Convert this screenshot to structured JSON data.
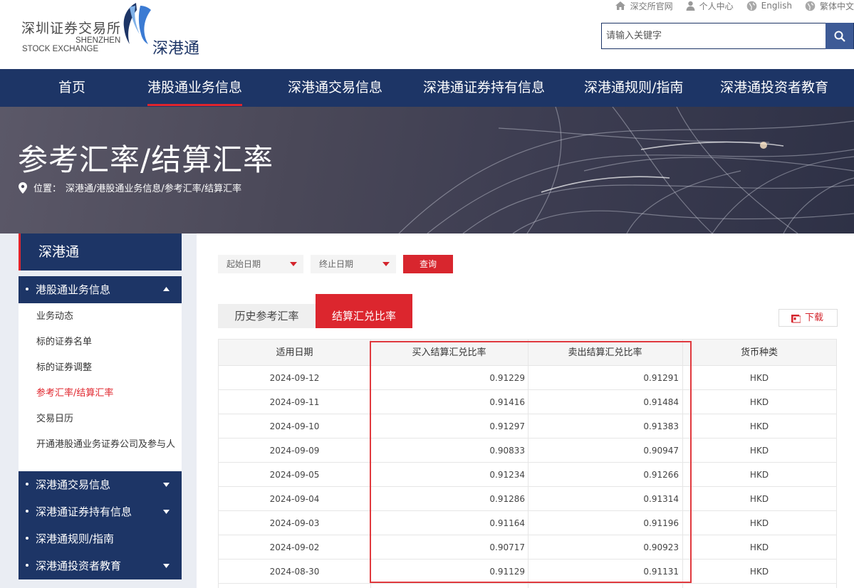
{
  "header": {
    "logo_cn": "深圳证券交易所",
    "logo_en_line1": "SHENZHEN",
    "logo_en_line2": "STOCK EXCHANGE",
    "sub_brand": "深港通",
    "top_links": [
      {
        "label": "深交所官网",
        "icon": "home-icon"
      },
      {
        "label": "个人中心",
        "icon": "user-icon"
      },
      {
        "label": "English",
        "icon": "globe-icon"
      },
      {
        "label": "繁体中文",
        "icon": "globe-icon"
      }
    ],
    "search_placeholder": "请输入关键字"
  },
  "nav": {
    "items": [
      "首页",
      "港股通业务信息",
      "深港通交易信息",
      "深港通证券持有信息",
      "深港通规则/指南",
      "深港通投资者教育"
    ],
    "active_index": 1
  },
  "banner": {
    "title": "参考汇率/结算汇率",
    "breadcrumb_prefix": "位置：",
    "breadcrumb": "深港通/港股通业务信息/参考汇率/结算汇率"
  },
  "sidebar": {
    "title": "深港通",
    "groups": [
      {
        "label": "港股通业务信息",
        "expanded": true
      },
      {
        "label": "深港通交易信息",
        "expanded": false
      },
      {
        "label": "深港通证券持有信息",
        "expanded": false
      },
      {
        "label": "深港通规则/指南",
        "expanded": false
      },
      {
        "label": "深港通投资者教育",
        "expanded": false
      }
    ],
    "sub_items": [
      "业务动态",
      "标的证券名单",
      "标的证券调整",
      "参考汇率/结算汇率",
      "交易日历",
      "开通港股通业务证券公司及参与人"
    ],
    "active_sub_index": 3
  },
  "filters": {
    "start_date_placeholder": "起始日期",
    "end_date_placeholder": "终止日期",
    "query_label": "查询"
  },
  "tabs": {
    "history": "历史参考汇率",
    "settlement": "结算汇兑比率",
    "active": "settlement"
  },
  "download_label": "下载",
  "table": {
    "headers": [
      "适用日期",
      "买入结算汇兑比率",
      "卖出结算汇兑比率",
      "货币种类"
    ],
    "rows": [
      [
        "2024-09-12",
        "0.91229",
        "0.91291",
        "HKD"
      ],
      [
        "2024-09-11",
        "0.91416",
        "0.91484",
        "HKD"
      ],
      [
        "2024-09-10",
        "0.91297",
        "0.91383",
        "HKD"
      ],
      [
        "2024-09-09",
        "0.90833",
        "0.90947",
        "HKD"
      ],
      [
        "2024-09-05",
        "0.91234",
        "0.91266",
        "HKD"
      ],
      [
        "2024-09-04",
        "0.91286",
        "0.91314",
        "HKD"
      ],
      [
        "2024-09-03",
        "0.91164",
        "0.91196",
        "HKD"
      ],
      [
        "2024-09-02",
        "0.90717",
        "0.90923",
        "HKD"
      ],
      [
        "2024-08-30",
        "0.91129",
        "0.91131",
        "HKD"
      ]
    ]
  },
  "colors": {
    "brand_navy": "#1d3566",
    "accent_red": "#e0242c",
    "highlight_border": "#e0393e"
  }
}
